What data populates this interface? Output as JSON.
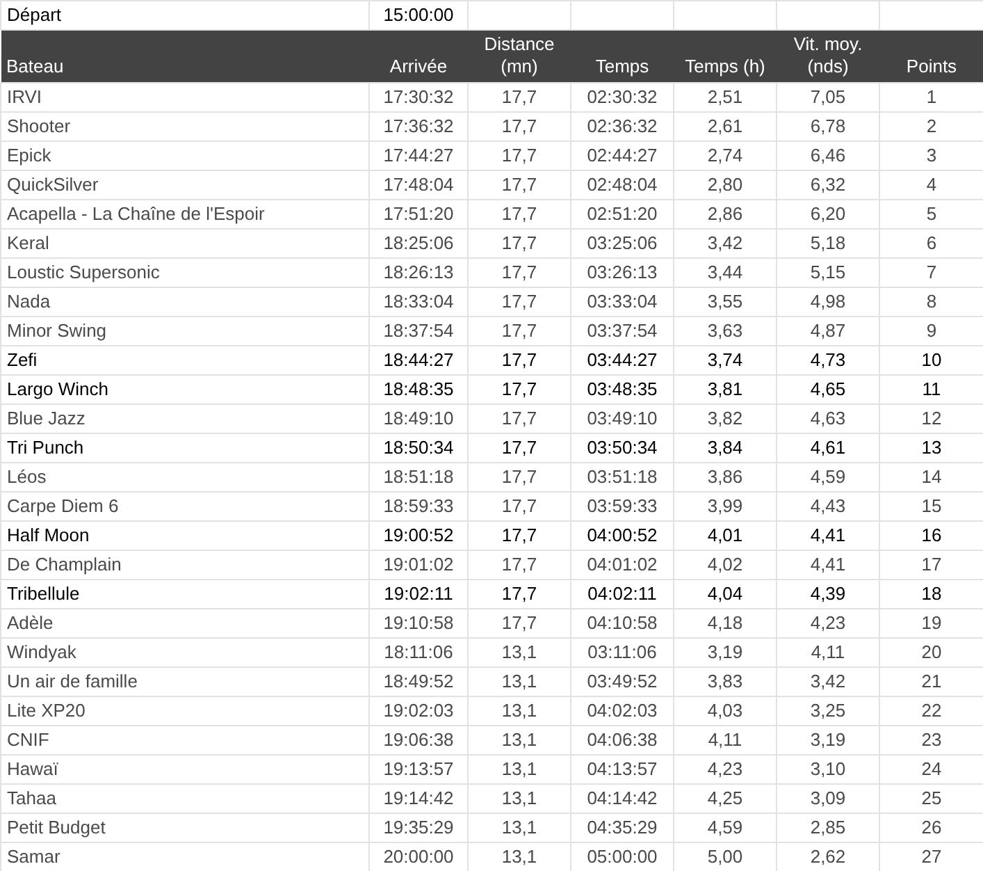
{
  "depart": {
    "label": "Départ",
    "time": "15:00:00"
  },
  "table": {
    "columns": [
      "Bateau",
      "Arrivée",
      "Distance (mn)",
      "Temps",
      "Temps (h)",
      "Vit. moy. (nds)",
      "Points"
    ],
    "rows": [
      {
        "cells": [
          "IRVI",
          "17:30:32",
          "17,7",
          "02:30:32",
          "2,51",
          "7,05",
          "1"
        ],
        "dark": false
      },
      {
        "cells": [
          "Shooter",
          "17:36:32",
          "17,7",
          "02:36:32",
          "2,61",
          "6,78",
          "2"
        ],
        "dark": false
      },
      {
        "cells": [
          "Epick",
          "17:44:27",
          "17,7",
          "02:44:27",
          "2,74",
          "6,46",
          "3"
        ],
        "dark": false
      },
      {
        "cells": [
          "QuickSilver",
          "17:48:04",
          "17,7",
          "02:48:04",
          "2,80",
          "6,32",
          "4"
        ],
        "dark": false
      },
      {
        "cells": [
          "Acapella - La Chaîne de l'Espoir",
          "17:51:20",
          "17,7",
          "02:51:20",
          "2,86",
          "6,20",
          "5"
        ],
        "dark": false
      },
      {
        "cells": [
          "Keral",
          "18:25:06",
          "17,7",
          "03:25:06",
          "3,42",
          "5,18",
          "6"
        ],
        "dark": false
      },
      {
        "cells": [
          "Loustic Supersonic",
          "18:26:13",
          "17,7",
          "03:26:13",
          "3,44",
          "5,15",
          "7"
        ],
        "dark": false
      },
      {
        "cells": [
          "Nada",
          "18:33:04",
          "17,7",
          "03:33:04",
          "3,55",
          "4,98",
          "8"
        ],
        "dark": false
      },
      {
        "cells": [
          "Minor Swing",
          "18:37:54",
          "17,7",
          "03:37:54",
          "3,63",
          "4,87",
          "9"
        ],
        "dark": false
      },
      {
        "cells": [
          "Zefi",
          "18:44:27",
          "17,7",
          "03:44:27",
          "3,74",
          "4,73",
          "10"
        ],
        "dark": true
      },
      {
        "cells": [
          "Largo Winch",
          "18:48:35",
          "17,7",
          "03:48:35",
          "3,81",
          "4,65",
          "11"
        ],
        "dark": true
      },
      {
        "cells": [
          "Blue Jazz",
          "18:49:10",
          "17,7",
          "03:49:10",
          "3,82",
          "4,63",
          "12"
        ],
        "dark": false
      },
      {
        "cells": [
          "Tri Punch",
          "18:50:34",
          "17,7",
          "03:50:34",
          "3,84",
          "4,61",
          "13"
        ],
        "dark": true
      },
      {
        "cells": [
          "Léos",
          "18:51:18",
          "17,7",
          "03:51:18",
          "3,86",
          "4,59",
          "14"
        ],
        "dark": false
      },
      {
        "cells": [
          "Carpe Diem 6",
          "18:59:33",
          "17,7",
          "03:59:33",
          "3,99",
          "4,43",
          "15"
        ],
        "dark": false
      },
      {
        "cells": [
          "Half Moon",
          "19:00:52",
          "17,7",
          "04:00:52",
          "4,01",
          "4,41",
          "16"
        ],
        "dark": true
      },
      {
        "cells": [
          "De Champlain",
          "19:01:02",
          "17,7",
          "04:01:02",
          "4,02",
          "4,41",
          "17"
        ],
        "dark": false
      },
      {
        "cells": [
          "Tribellule",
          "19:02:11",
          "17,7",
          "04:02:11",
          "4,04",
          "4,39",
          "18"
        ],
        "dark": true
      },
      {
        "cells": [
          "Adèle",
          "19:10:58",
          "17,7",
          "04:10:58",
          "4,18",
          "4,23",
          "19"
        ],
        "dark": false
      },
      {
        "cells": [
          "Windyak",
          "18:11:06",
          "13,1",
          "03:11:06",
          "3,19",
          "4,11",
          "20"
        ],
        "dark": false
      },
      {
        "cells": [
          "Un air de famille",
          "18:49:52",
          "13,1",
          "03:49:52",
          "3,83",
          "3,42",
          "21"
        ],
        "dark": false
      },
      {
        "cells": [
          "Lite XP20",
          "19:02:03",
          "13,1",
          "04:02:03",
          "4,03",
          "3,25",
          "22"
        ],
        "dark": false
      },
      {
        "cells": [
          "CNIF",
          "19:06:38",
          "13,1",
          "04:06:38",
          "4,11",
          "3,19",
          "23"
        ],
        "dark": false
      },
      {
        "cells": [
          "Hawaï",
          "19:13:57",
          "13,1",
          "04:13:57",
          "4,23",
          "3,10",
          "24"
        ],
        "dark": false
      },
      {
        "cells": [
          "Tahaa",
          "19:14:42",
          "13,1",
          "04:14:42",
          "4,25",
          "3,09",
          "25"
        ],
        "dark": false
      },
      {
        "cells": [
          "Petit Budget",
          "19:35:29",
          "13,1",
          "04:35:29",
          "4,59",
          "2,85",
          "26"
        ],
        "dark": false
      },
      {
        "cells": [
          "Samar",
          "20:00:00",
          "13,1",
          "05:00:00",
          "5,00",
          "2,62",
          "27"
        ],
        "dark": false
      }
    ]
  }
}
